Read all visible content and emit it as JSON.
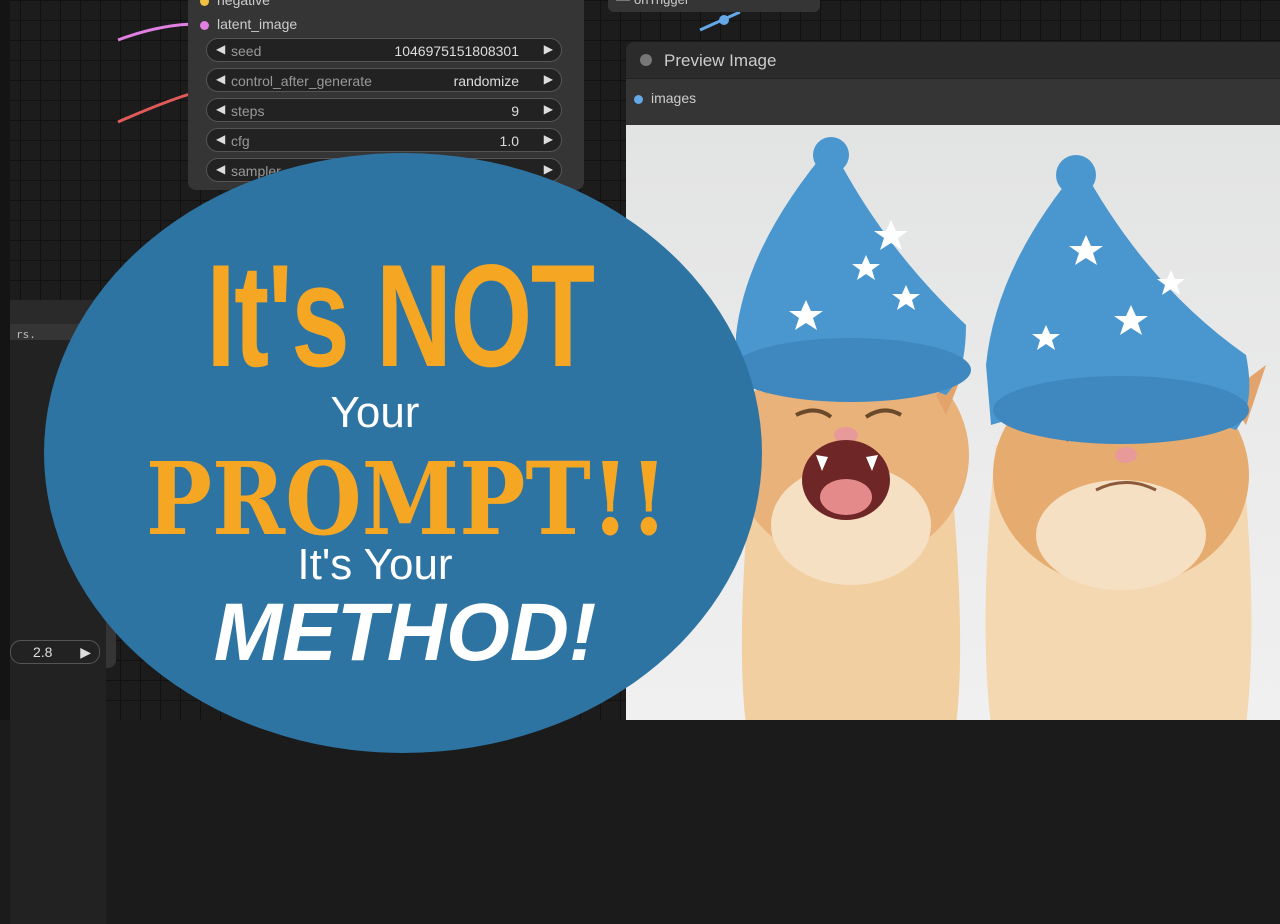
{
  "ksampler": {
    "inputs": {
      "negative": "negative",
      "latent_image": "latent_image"
    },
    "widgets": [
      {
        "label": "seed",
        "value": "1046975151808301"
      },
      {
        "label": "control_after_generate",
        "value": "randomize"
      },
      {
        "label": "steps",
        "value": "9"
      },
      {
        "label": "cfg",
        "value": "1.0"
      },
      {
        "label": "sampler",
        "value": ""
      }
    ]
  },
  "top_node": {
    "title": "onTrigger"
  },
  "left_node": {
    "text": "rs.",
    "widget_value": "2.8"
  },
  "preview": {
    "title": "Preview Image",
    "input": "images"
  },
  "overlay": {
    "line1": "It's NOT",
    "line2": "Your",
    "line3": "PROMPT!!",
    "line4": "It's Your",
    "line5": "METHOD!"
  },
  "colors": {
    "circle": "#2d74a3",
    "accent_orange": "#f5a623",
    "latent_dot": "#e27fe2",
    "images_dot": "#64a8e8",
    "hat_blue": "#4a97cf"
  },
  "icons": [
    "arrow-left-icon",
    "arrow-right-icon",
    "input-dot-icon",
    "node-status-icon"
  ]
}
